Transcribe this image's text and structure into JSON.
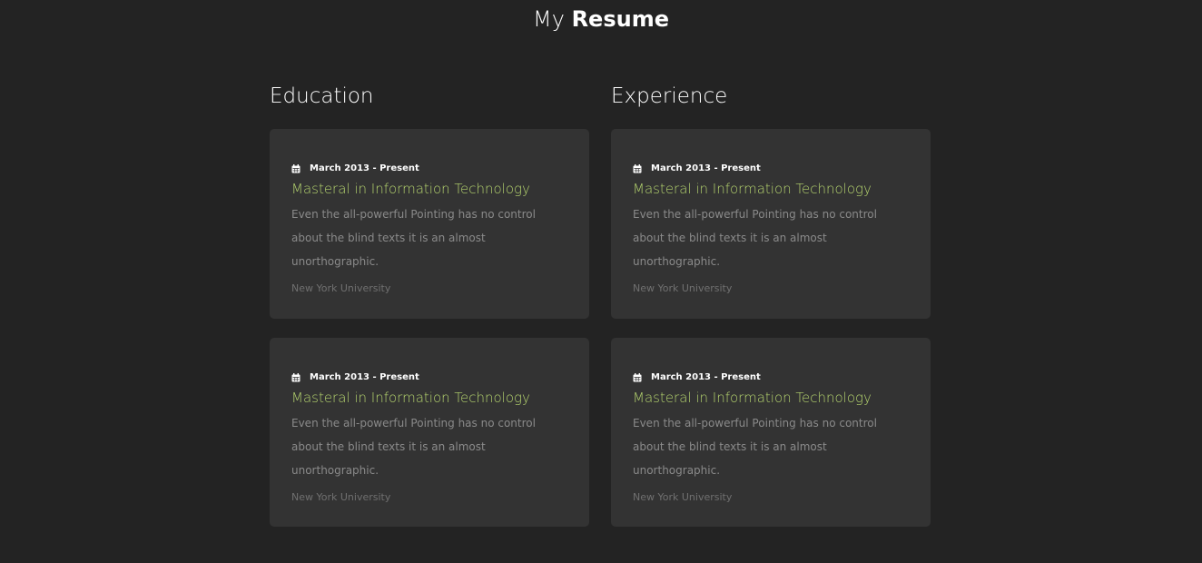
{
  "header": {
    "title_light": "My",
    "title_bold": "Resume"
  },
  "colors": {
    "background": "#232323",
    "card": "#333333",
    "accent": "#b4d36e"
  },
  "education": {
    "heading": "Education",
    "entries": [
      {
        "date": "March 2013 - Present",
        "degree": "Masteral in Information Technology",
        "description": "Even the all-powerful Pointing has no control about the blind texts it is an almost unorthographic.",
        "school": "New York University"
      },
      {
        "date": "March 2013 - Present",
        "degree": "Masteral in Information Technology",
        "description": "Even the all-powerful Pointing has no control about the blind texts it is an almost unorthographic.",
        "school": "New York University"
      }
    ]
  },
  "experience": {
    "heading": "Experience",
    "entries": [
      {
        "date": "March 2013 - Present",
        "degree": "Masteral in Information Technology",
        "description": "Even the all-powerful Pointing has no control about the blind texts it is an almost unorthographic.",
        "school": "New York University"
      },
      {
        "date": "March 2013 - Present",
        "degree": "Masteral in Information Technology",
        "description": "Even the all-powerful Pointing has no control about the blind texts it is an almost unorthographic.",
        "school": "New York University"
      }
    ]
  },
  "icons": {
    "date": "calendar-icon"
  }
}
